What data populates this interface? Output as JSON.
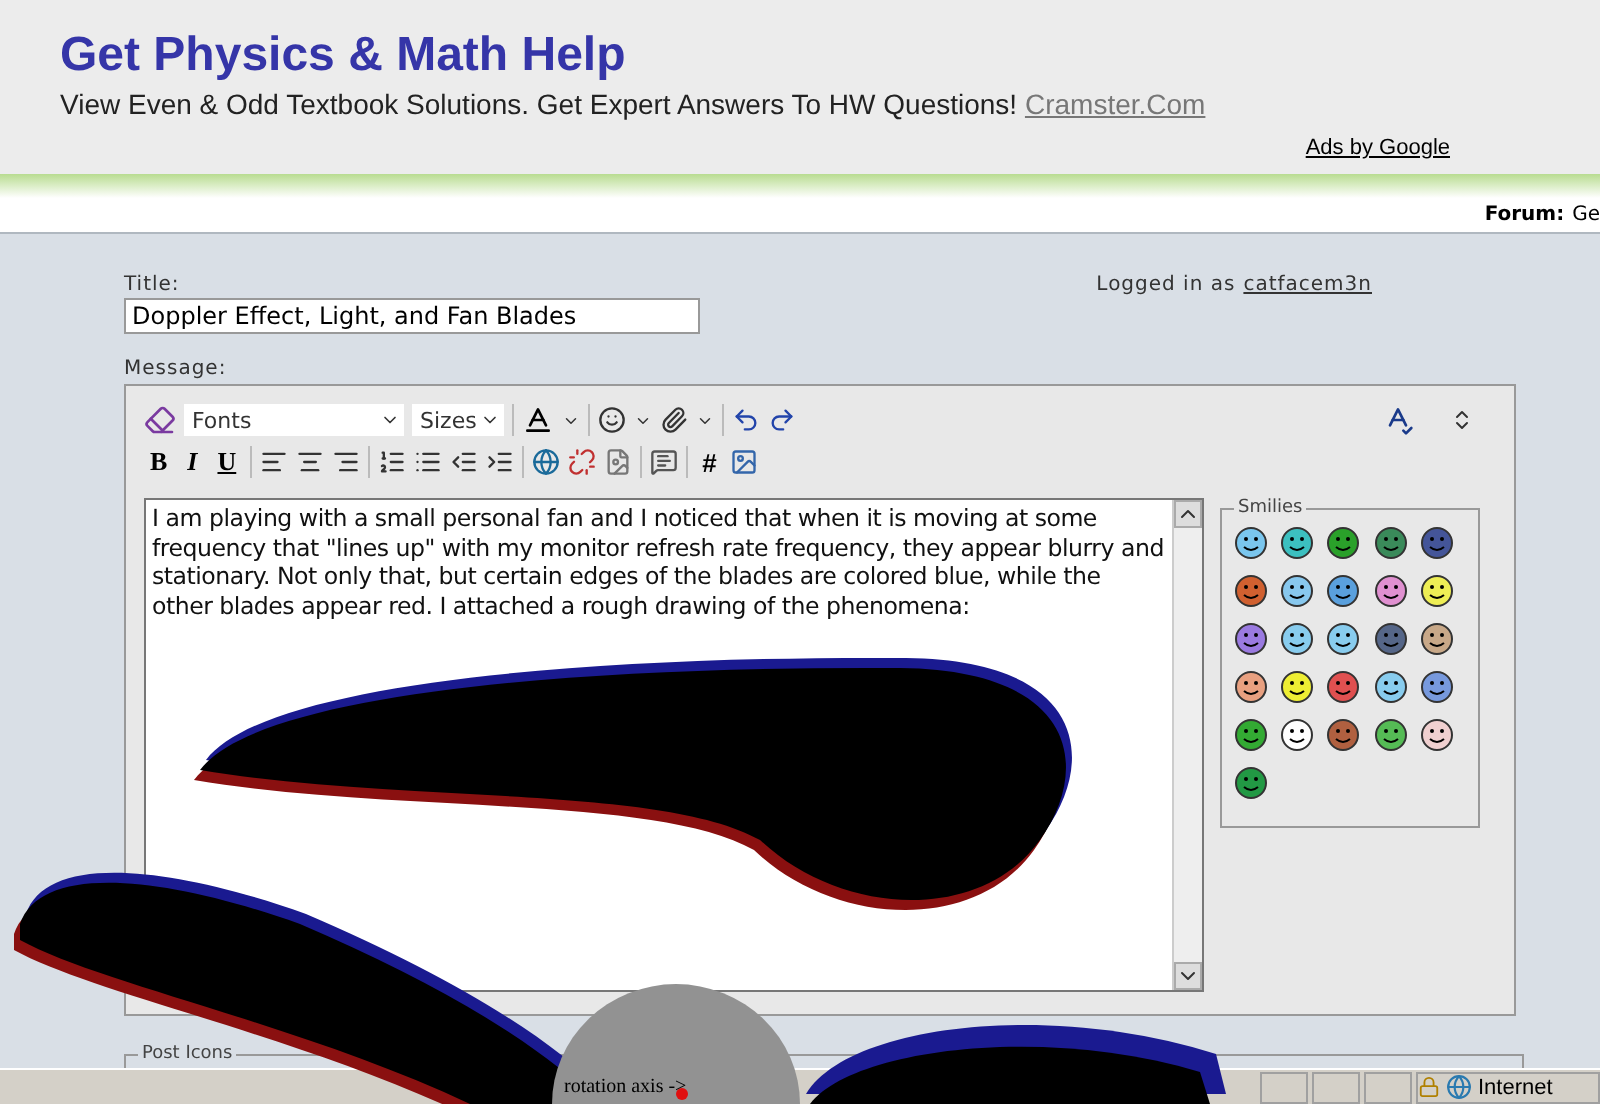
{
  "ad": {
    "headline": "Get Physics & Math Help",
    "text": "View Even & Odd Textbook Solutions. Get Expert Answers To HW Questions!",
    "link": "Cramster.Com",
    "attribution": "Ads by Google"
  },
  "nav": {
    "forum_label": "Forum:",
    "forum_value": "Ge"
  },
  "form": {
    "title_label": "Title:",
    "title_value": "Doppler Effect, Light, and Fan Blades",
    "logged_in_text": "Logged in as",
    "username": "catfacem3n",
    "message_label": "Message:"
  },
  "toolbar": {
    "font_select": "Fonts",
    "size_select": "Sizes",
    "format_buttons": [
      "B",
      "I",
      "U"
    ],
    "code_button": "#"
  },
  "message_body": "I am playing with a small personal fan and I noticed that when it is moving at some frequency that \"lines up\" with my monitor refresh rate frequency, they appear blurry and stationary. Not only that, but certain edges of the blades are colored blue, while the other blades appear red. I attached a rough drawing of the phenomena:",
  "smilies_label": "Smilies",
  "post_icons_label": "Post Icons",
  "drawing": {
    "axis_label": "rotation axis ->"
  },
  "status_bar": {
    "zone": "Internet"
  }
}
